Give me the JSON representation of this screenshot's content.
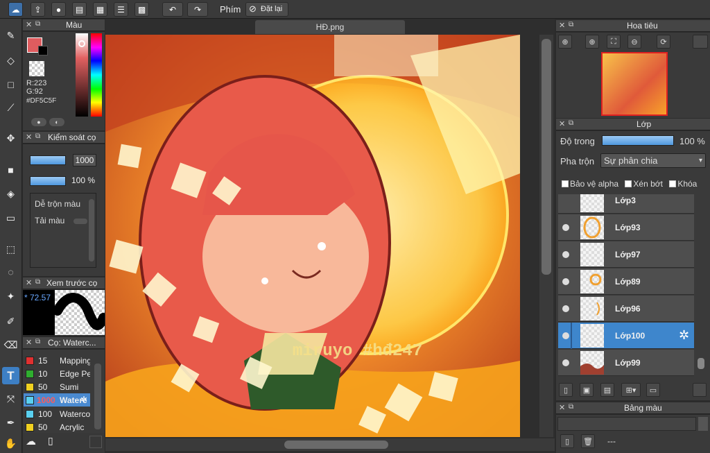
{
  "toolbar": {
    "shortcut_label": "Phím",
    "reset_label": "Đặt lại"
  },
  "document": {
    "tab_title": "HĐ.png"
  },
  "color_panel": {
    "title": "Màu",
    "r": "R:223",
    "g": "G:92",
    "hex": "#DF5C5F",
    "primary_color": "#DF5C5F"
  },
  "brush_control": {
    "title": "Kiểm soát cọ",
    "size_value": "1000",
    "opacity_value": "100 %",
    "blend_label": "Dễ trộn màu",
    "load_label": "Tải màu"
  },
  "preview": {
    "title": "Xem trước cọ",
    "value": "* 72.57"
  },
  "brush_list": {
    "title": "Cọ: Waterc...",
    "items": [
      {
        "size": "15",
        "name": "Mapping",
        "color": "#e03030"
      },
      {
        "size": "10",
        "name": "Edge Pe",
        "color": "#2fae2f"
      },
      {
        "size": "50",
        "name": "Sumi",
        "color": "#f0d020"
      },
      {
        "size": "1000",
        "name": "Waterc",
        "color": "#5ad0f0"
      },
      {
        "size": "100",
        "name": "Waterco",
        "color": "#5ad0f0"
      },
      {
        "size": "50",
        "name": "Acrylic",
        "color": "#f0d020"
      }
    ]
  },
  "navigator": {
    "title": "Hoa tiêu"
  },
  "layers": {
    "title": "Lớp",
    "opacity_label": "Độ trong",
    "opacity_value": "100 %",
    "opacity_fraction": 1.0,
    "blend_label": "Pha trộn",
    "blend_value": "Sự phân chia",
    "protect_alpha": "Bảo vệ alpha",
    "clipping": "Xén bớt",
    "lock": "Khóa",
    "items": [
      {
        "name": "Lớp3"
      },
      {
        "name": "Lớp93"
      },
      {
        "name": "Lớp97"
      },
      {
        "name": "Lớp89"
      },
      {
        "name": "Lớp96"
      },
      {
        "name": "Lớp100"
      },
      {
        "name": "Lớp99"
      }
    ]
  },
  "palette": {
    "title": "Bảng màu",
    "footer_text": "---"
  },
  "watermark": "miruyo #hđ247"
}
